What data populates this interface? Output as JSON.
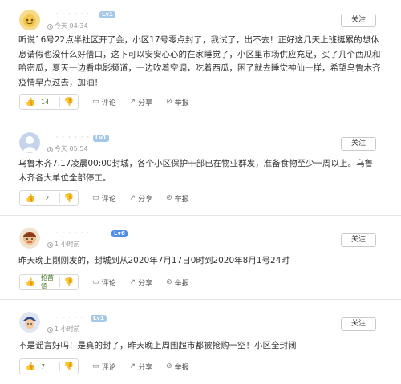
{
  "posts": [
    {
      "username": "· · · · · · ·",
      "level": "Lv1",
      "time": "今天 04:34",
      "follow": "关注",
      "content": "听说16号22点半社区开了会，小区17号零点封了，我试了，出不去！正好这几天上班挺累的想休息请假也没什么好借口，这下可以安安心心的在家睡觉了，小区里市场供应充足，买了几个西瓜和哈密瓜，夏天一边看电影频道，一边吹着空调，吃着西瓜，困了就去睡觉神仙一样，希望乌鲁木齐疫情早点过去，加油！",
      "likes": "14",
      "comment": "评论",
      "share": "分享",
      "report": "举报"
    },
    {
      "username": "· · · · · · ·",
      "level": "Lv1",
      "time": "今天 05:54",
      "follow": "关注",
      "content": "乌鲁木齐7.17凌晨00:00封城，各个小区保护干部已在物业群发，准备食物至少一周以上。乌鲁木齐各大单位全部停工。",
      "likes": "12",
      "comment": "评论",
      "share": "分享",
      "report": "举报"
    },
    {
      "username": "· · · · · · ·",
      "level": "Lv6",
      "time": "1 小时前",
      "follow": "关注",
      "content": "昨天晚上刚刚发的，封城到从2020年7月17日0时到2020年8月1号24时",
      "likes": "抢首赞",
      "comment": "评论",
      "share": "分享",
      "report": "举报"
    },
    {
      "username": "· · · · · ·",
      "level": "Lv1",
      "time": "1 小时前",
      "follow": "关注",
      "content": "不是谣言好吗！是真的封了，昨天晚上周围超市都被抢购一空！小区全封闭",
      "likes": "7",
      "comment": "评论",
      "share": "分享",
      "report": "举报"
    }
  ],
  "icons": {
    "thumb_up": "thumb-up-icon",
    "thumb_down": "thumb-down-icon",
    "comment": "comment-icon",
    "share": "share-icon",
    "report": "report-icon",
    "clock": "clock-icon"
  },
  "colors": {
    "accent_green": "#55a22b",
    "level_lv1": "#a6c8e8",
    "level_lv6": "#4f8fe8"
  }
}
